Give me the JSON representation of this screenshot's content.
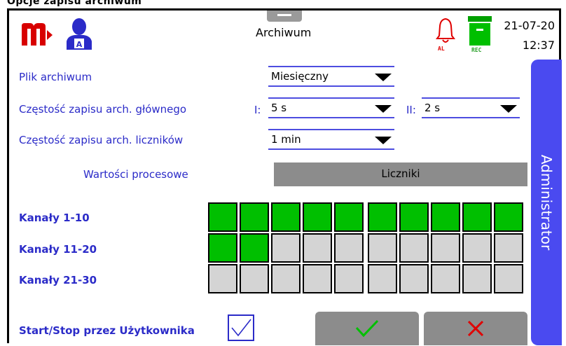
{
  "caption": "Opcje zapisu archiwum",
  "header": {
    "title": "Archiwum",
    "alarm_label": "AL",
    "rec_label": "REC",
    "date": "21-07-20",
    "time": "12:37",
    "icons": {
      "logo": "m-logo",
      "user": "user-admin-icon",
      "alarm": "bell-icon",
      "rec": "archive-rec-icon"
    }
  },
  "settings": {
    "archive_file": {
      "label": "Plik archiwum",
      "value": "Miesięczny"
    },
    "main_freq": {
      "label": "Częstość zapisu arch. głównego",
      "i_prefix": "I:",
      "i_value": "5 s",
      "ii_prefix": "II:",
      "ii_value": "2 s"
    },
    "counter_freq": {
      "label": "Częstość zapisu arch. liczników",
      "value": "1 min"
    }
  },
  "tabs": {
    "process": "Wartości procesowe",
    "counters": "Liczniki"
  },
  "channels": [
    {
      "label": "Kanały 1-10",
      "enabled": [
        true,
        true,
        true,
        true,
        true,
        true,
        true,
        true,
        true,
        true
      ]
    },
    {
      "label": "Kanały 11-20",
      "enabled": [
        true,
        true,
        false,
        false,
        false,
        false,
        false,
        false,
        false,
        false
      ]
    },
    {
      "label": "Kanały 21-30",
      "enabled": [
        false,
        false,
        false,
        false,
        false,
        false,
        false,
        false,
        false,
        false
      ]
    }
  ],
  "start_stop": {
    "label": "Start/Stop przez Użytkownika",
    "checked": true
  },
  "side_button": "Administrator",
  "colors": {
    "accent": "#4a4af0",
    "label": "#2b2bc8",
    "on": "#00bf00",
    "off": "#d4d4d4",
    "logo_red": "#d80000"
  }
}
